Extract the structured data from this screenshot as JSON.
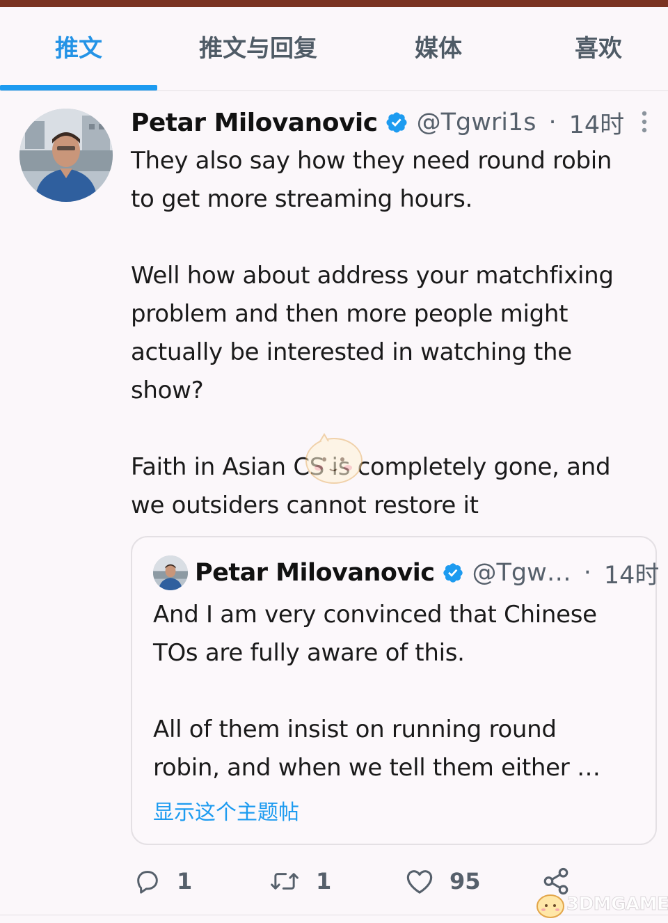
{
  "tabs": [
    {
      "label": "推文",
      "active": true
    },
    {
      "label": "推文与回复",
      "active": false
    },
    {
      "label": "媒体",
      "active": false
    },
    {
      "label": "喜欢",
      "active": false
    }
  ],
  "colors": {
    "accent": "#1d9bf0",
    "verified_badge": "#1d9bf0",
    "text_primary": "#1a1a1a",
    "text_secondary": "#56606b"
  },
  "tweet": {
    "author_name": "Petar Milovanovic",
    "verified": true,
    "handle": "@Tgwri1s",
    "separator": "·",
    "time": "14时",
    "more_icon": "more-vertical-icon",
    "paragraphs": [
      "They also say how they need round robin\nto get more streaming hours.",
      "Well how about address your matchfixing\nproblem and then more people might\nactually be interested in watching the\nshow?",
      "Faith in Asian CS is completely gone, and\nwe outsiders cannot restore it"
    ]
  },
  "quote": {
    "author_name": "Petar Milovanovic",
    "verified": true,
    "handle": "@Tgw…",
    "separator": "·",
    "time": "14时",
    "paragraphs": [
      "And I am very convinced that Chinese\nTOs are fully aware of this.",
      "All of them insist on running round\nrobin, and when we tell them either …"
    ],
    "show_thread_label": "显示这个主题帖"
  },
  "actions": {
    "reply": {
      "icon": "reply-icon",
      "count": "1"
    },
    "retweet": {
      "icon": "retweet-icon",
      "count": "1"
    },
    "like": {
      "icon": "heart-icon",
      "count": "95"
    },
    "share": {
      "icon": "share-icon"
    }
  },
  "watermark": {
    "text": "3DMGAME"
  }
}
